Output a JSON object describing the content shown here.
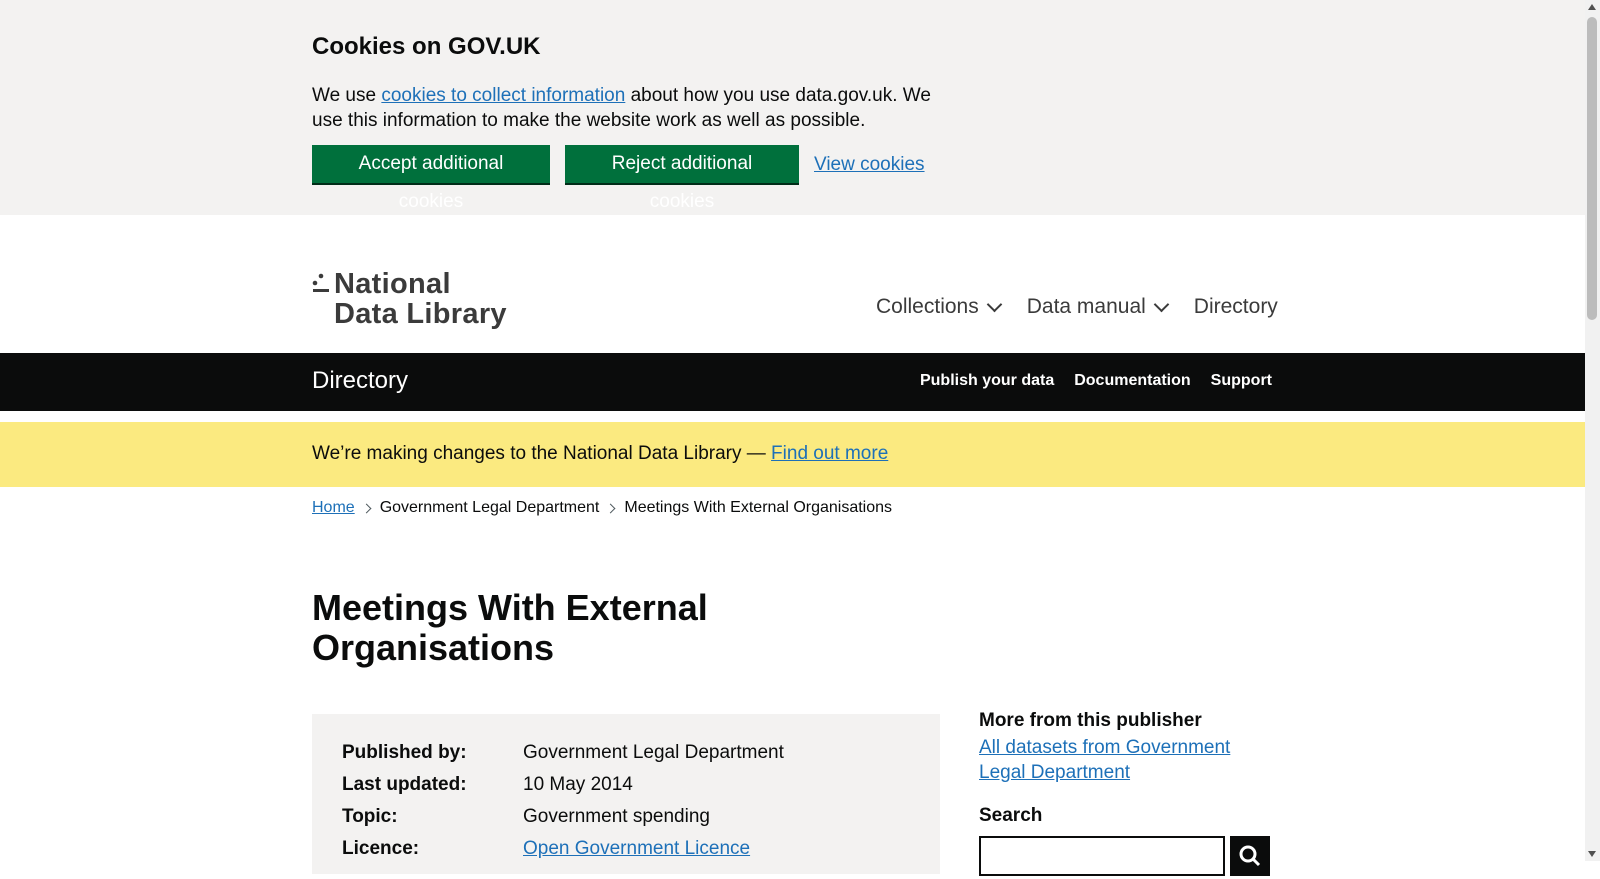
{
  "cookie_banner": {
    "title": "Cookies on GOV.UK",
    "text_before": "We use ",
    "link_text": "cookies to collect information",
    "text_after": " about how you use data.gov.uk. We use this information to make the website work as well as possible.",
    "accept_label": "Accept additional cookies",
    "reject_label": "Reject additional cookies",
    "view_label": "View cookies"
  },
  "header": {
    "logo_line1": "National",
    "logo_line2": "Data Library",
    "nav": [
      {
        "label": "Collections"
      },
      {
        "label": "Data manual"
      },
      {
        "label": "Directory"
      }
    ]
  },
  "subnav": {
    "title": "Directory",
    "links": [
      "Publish your data",
      "Documentation",
      "Support"
    ]
  },
  "notice": {
    "text": "We’re making changes to the National Data Library — ",
    "link": "Find out more"
  },
  "breadcrumb": {
    "items": [
      "Home",
      "Government Legal Department",
      "Meetings With External Organisations"
    ]
  },
  "page_title": "Meetings With External Organisations",
  "summary": {
    "rows": [
      {
        "key": "Published by:",
        "value": "Government Legal Department"
      },
      {
        "key": "Last updated:",
        "value": "10 May 2014"
      },
      {
        "key": "Topic:",
        "value": "Government spending"
      },
      {
        "key": "Licence:",
        "value": "Open Government Licence"
      }
    ]
  },
  "sidebar": {
    "heading": "More from this publisher",
    "link": "All datasets from Government Legal Department",
    "search_label": "Search",
    "search_value": ""
  },
  "colors": {
    "green_button": "#00703c",
    "link": "#1d70b8",
    "notice_bg": "#fbea80",
    "bar_bg": "#0b0c0c"
  }
}
